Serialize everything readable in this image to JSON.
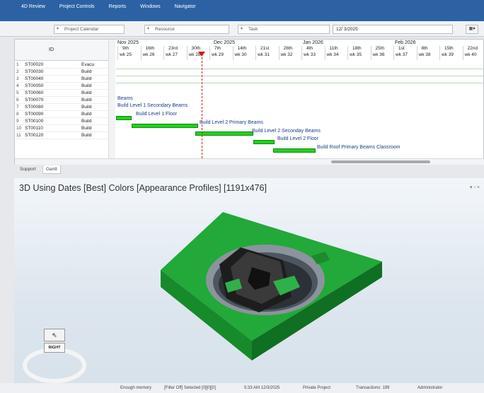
{
  "menu": [
    "4D Review",
    "Project Controls",
    "Reports",
    "Windows",
    "Navigator"
  ],
  "filters": {
    "calendar": "Project Calendar",
    "resource": "Resource",
    "task": "Task",
    "date": "12/ 3/2025"
  },
  "grid": {
    "id_header": "ID",
    "rows": [
      {
        "n": "1",
        "id": "ST00020",
        "name": "Evacu"
      },
      {
        "n": "2",
        "id": "ST00030",
        "name": "Build"
      },
      {
        "n": "3",
        "id": "ST00040",
        "name": "Build"
      },
      {
        "n": "4",
        "id": "ST00050",
        "name": "Build"
      },
      {
        "n": "5",
        "id": "ST00060",
        "name": "Build"
      },
      {
        "n": "6",
        "id": "ST00070",
        "name": "Build"
      },
      {
        "n": "7",
        "id": "ST00080",
        "name": "Build"
      },
      {
        "n": "8",
        "id": "ST00090",
        "name": "Build"
      },
      {
        "n": "9",
        "id": "ST00100",
        "name": "Build"
      },
      {
        "n": "10",
        "id": "ST00110",
        "name": "Build"
      },
      {
        "n": "11",
        "id": "ST00120",
        "name": "Build"
      }
    ]
  },
  "timeline": {
    "months": [
      "Nov 2025",
      "Dec 2025",
      "Jan 2026",
      "Feb 2026"
    ],
    "days": [
      "9th",
      "16th",
      "23rd",
      "30th",
      "7th",
      "14th",
      "21st",
      "28th",
      "4th",
      "11th",
      "18th",
      "25th",
      "1st",
      "8th",
      "15th",
      "22nd"
    ],
    "weeks": [
      "wk 25",
      "wk 26",
      "wk 27",
      "wk 28",
      "wk 29",
      "wk 30",
      "wk 31",
      "wk 32",
      "wk 33",
      "wk 34",
      "wk 35",
      "wk 36",
      "wk 37",
      "wk 38",
      "wk 39",
      "wk 40"
    ]
  },
  "bar_labels": [
    "Beams",
    "Build Level 1 Secondary Beams",
    "Build Level 1 Floor",
    "Build Level 2 Primary Beams",
    "Build Level 2 Seconday Beams",
    "Build Level 2 Floor",
    "Build Roof Primary Beams Classroom"
  ],
  "tabs": [
    "Support",
    "Gantt"
  ],
  "panel": {
    "title": "3D Using Dates [Best] Colors [Appearance Profiles]  [1191x476]",
    "controls": "▾ ▫ ×"
  },
  "navcube": {
    "face": "RIGHT"
  },
  "status": [
    "Enough memory",
    "[Filter Off]  Selected [0][0][0]",
    "5:33 AM 12/3/2025",
    "Private Project",
    "Transactions: 199",
    "Administrator"
  ],
  "colors": {
    "ribbon": "#2c62a4",
    "bar": "#22d11c",
    "slab": "#1a9f2e",
    "today": "#dd1111"
  }
}
